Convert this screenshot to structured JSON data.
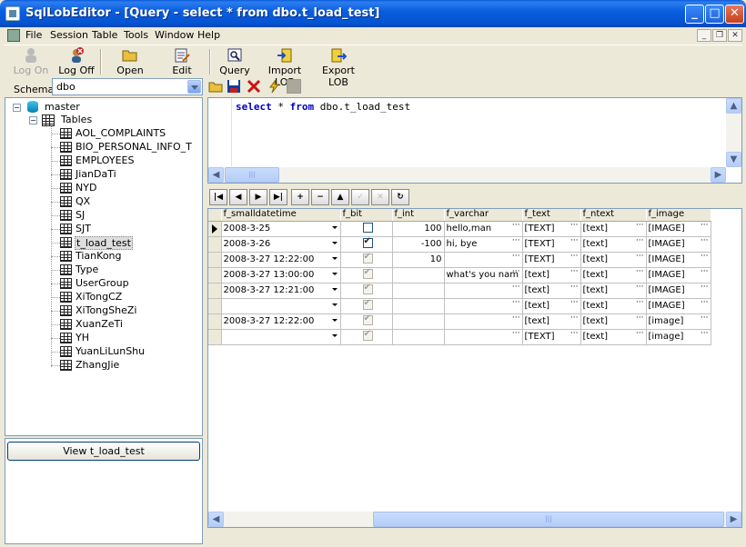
{
  "window": {
    "title": "SqlLobEditor - [Query - select * from dbo.t_load_test]"
  },
  "menu": [
    "File",
    "Session",
    "Table",
    "Tools",
    "Window",
    "Help"
  ],
  "toolbar": {
    "logon": "Log On",
    "logoff": "Log Off",
    "opensql": "Open Sql",
    "editdata": "Edit Data",
    "query": "Query",
    "importlob": "Import LOB",
    "exportlob": "Export LOB"
  },
  "schema": {
    "label": "Schema",
    "value": "dbo"
  },
  "tree": {
    "root": "master",
    "tables_label": "Tables",
    "tables": [
      "AOL_COMPLAINTS",
      "BIO_PERSONAL_INFO_T",
      "EMPLOYEES",
      "JianDaTi",
      "NYD",
      "QX",
      "SJ",
      "SJT",
      "t_load_test",
      "TianKong",
      "Type",
      "UserGroup",
      "XiTongCZ",
      "XiTongSheZi",
      "XuanZeTi",
      "YH",
      "YuanLiLunShu",
      "ZhangJie"
    ],
    "selected": "t_load_test"
  },
  "view_button": "View t_load_test",
  "sql": {
    "kw1": "select",
    "mid": " * ",
    "kw2": "from",
    "rest": " dbo.t_load_test"
  },
  "grid": {
    "columns": [
      "f_smalldatetime",
      "f_bit",
      "f_int",
      "f_varchar",
      "f_text",
      "f_ntext",
      "f_image"
    ],
    "rows": [
      {
        "date": "2008-3-25",
        "bit": "unchecked",
        "int": "100",
        "varchar": "hello,man",
        "text": "[TEXT]",
        "ntext": "[text]",
        "image": "[IMAGE]"
      },
      {
        "date": "2008-3-26",
        "bit": "checked",
        "int": "-100",
        "varchar": "hi, bye",
        "text": "[TEXT]",
        "ntext": "[text]",
        "image": "[IMAGE]"
      },
      {
        "date": "2008-3-27 12:22:00",
        "bit": "gray-checked",
        "int": "10",
        "varchar": "",
        "text": "[TEXT]",
        "ntext": "[text]",
        "image": "[IMAGE]"
      },
      {
        "date": "2008-3-27 13:00:00",
        "bit": "gray-checked",
        "int": "",
        "varchar": "what's you nam",
        "text": "[text]",
        "ntext": "[text]",
        "image": "[IMAGE]"
      },
      {
        "date": "2008-3-27 12:21:00",
        "bit": "gray-checked",
        "int": "",
        "varchar": "",
        "text": "[text]",
        "ntext": "[text]",
        "image": "[IMAGE]"
      },
      {
        "date": "",
        "bit": "gray-checked",
        "int": "",
        "varchar": "",
        "text": "[text]",
        "ntext": "[text]",
        "image": "[IMAGE]"
      },
      {
        "date": "2008-3-27 12:22:00",
        "bit": "gray-checked",
        "int": "",
        "varchar": "",
        "text": "[text]",
        "ntext": "[text]",
        "image": "[image]"
      },
      {
        "date": "",
        "bit": "gray-checked",
        "int": "",
        "varchar": "",
        "text": "[TEXT]",
        "ntext": "[text]",
        "image": "[image]"
      }
    ]
  }
}
